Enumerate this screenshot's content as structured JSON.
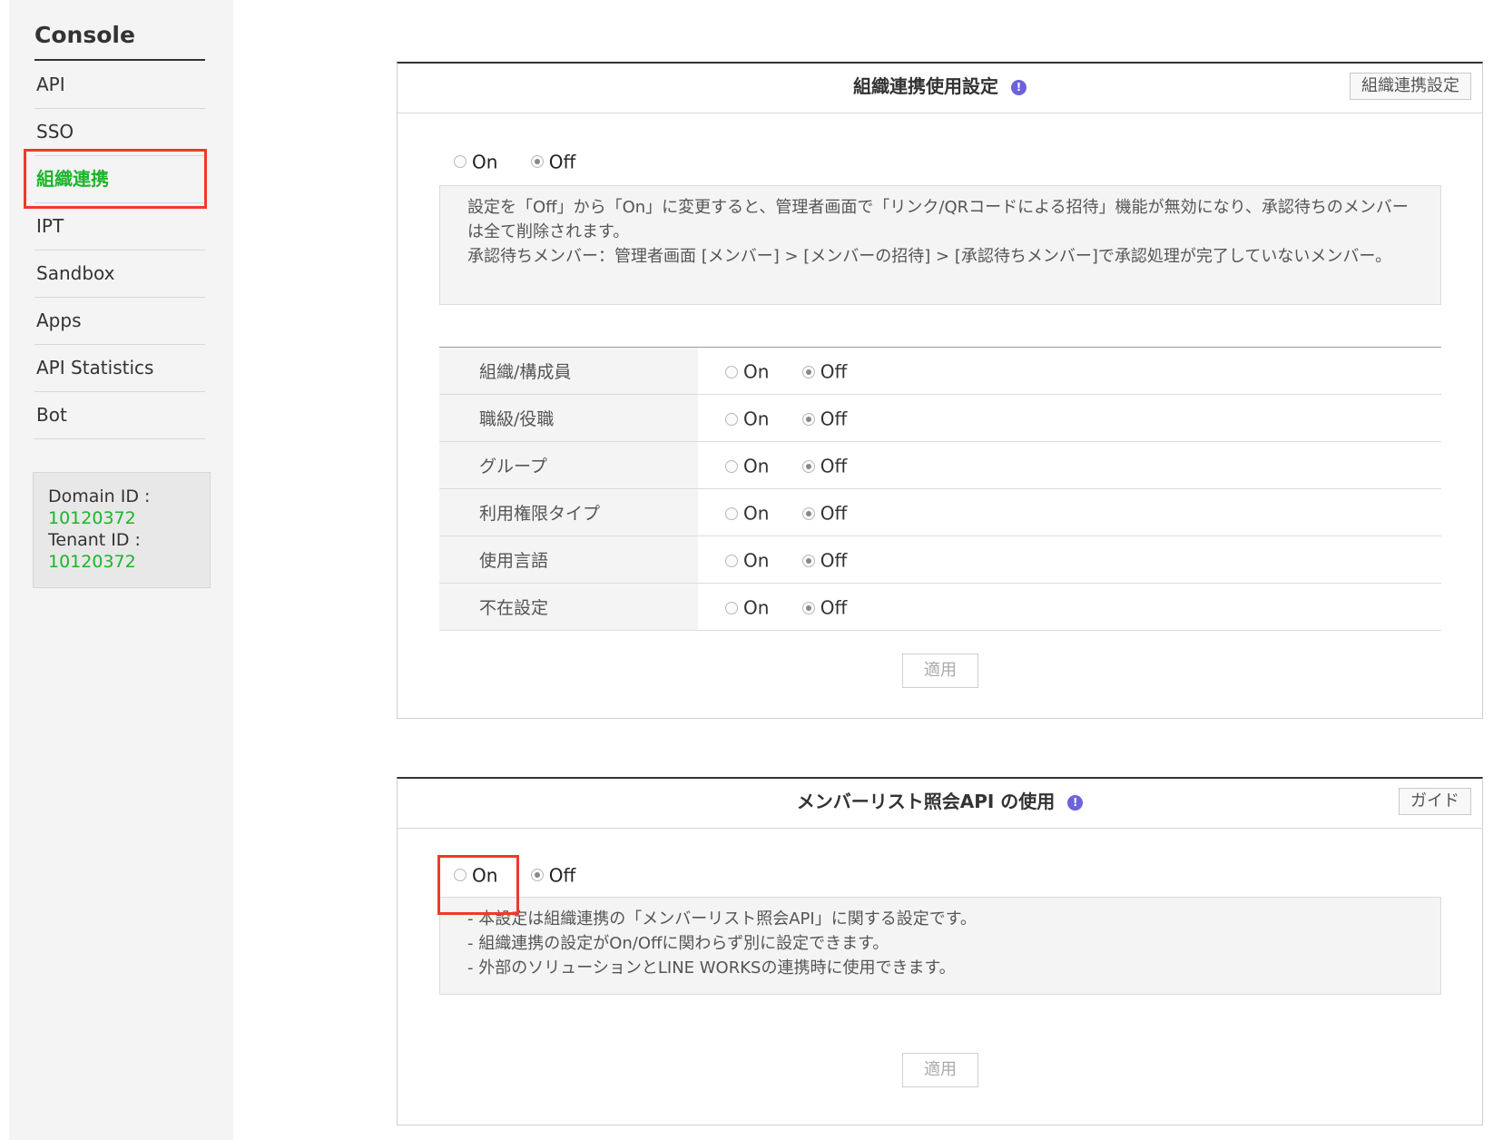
{
  "sidebar": {
    "title": "Console",
    "items": [
      {
        "label": "API"
      },
      {
        "label": "SSO"
      },
      {
        "label": "組織連携"
      },
      {
        "label": "IPT"
      },
      {
        "label": "Sandbox"
      },
      {
        "label": "Apps"
      },
      {
        "label": "API Statistics"
      },
      {
        "label": "Bot"
      }
    ],
    "domain_id_label": "Domain ID :",
    "domain_id_value": "10120372",
    "tenant_id_label": "Tenant ID :",
    "tenant_id_value": "10120372"
  },
  "org_panel": {
    "title": "組織連携使用設定",
    "info_glyph": "!",
    "header_button": "組織連携設定",
    "master_on": "On",
    "master_off": "Off",
    "notice_line1": "設定を「Off」から「On」に変更すると、管理者画面で「リンク/QRコードによる招待」機能が無効になり、承認待ちのメンバーは全て削除されます。",
    "notice_line2": "承認待ちメンバー：管理者画面 [メンバー] > [メンバーの招待] > [承認待ちメンバー]で承認処理が完了していないメンバー。",
    "rows": [
      {
        "label": "組織/構成員",
        "on": "On",
        "off": "Off"
      },
      {
        "label": "職級/役職",
        "on": "On",
        "off": "Off"
      },
      {
        "label": "グループ",
        "on": "On",
        "off": "Off"
      },
      {
        "label": "利用権限タイプ",
        "on": "On",
        "off": "Off"
      },
      {
        "label": "使用言語",
        "on": "On",
        "off": "Off"
      },
      {
        "label": "不在設定",
        "on": "On",
        "off": "Off"
      }
    ],
    "apply_label": "適用"
  },
  "member_panel": {
    "title": "メンバーリスト照会API の使用",
    "info_glyph": "!",
    "header_button": "ガイド",
    "on": "On",
    "off": "Off",
    "notes": [
      "- 本設定は組織連携の「メンバーリスト照会API」に関する設定です。",
      "- 組織連携の設定がOn/Offに関わらず別に設定できます。",
      "- 外部のソリューションとLINE WORKSの連携時に使用できます。"
    ],
    "apply_label": "適用"
  },
  "colors": {
    "accent_green": "#1bb52a",
    "highlight_red": "#ee3a2a",
    "info_purple": "#6b63d9"
  }
}
